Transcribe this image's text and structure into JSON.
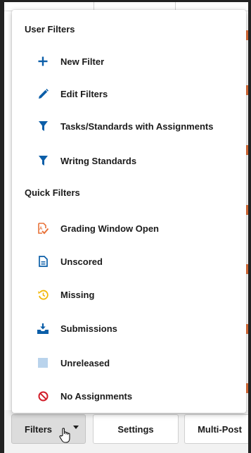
{
  "menu": {
    "user_filters_title": "User Filters",
    "quick_filters_title": "Quick Filters",
    "user_filters": [
      {
        "label": "New Filter",
        "icon": "plus-icon"
      },
      {
        "label": "Edit Filters",
        "icon": "pencil-icon"
      },
      {
        "label": "Tasks/Standards with Assignments",
        "icon": "funnel-icon"
      },
      {
        "label": "Writng Standards",
        "icon": "funnel-icon"
      }
    ],
    "quick_filters": [
      {
        "label": "Grading Window Open",
        "icon": "grading-window-icon"
      },
      {
        "label": "Unscored",
        "icon": "document-icon"
      },
      {
        "label": "Missing",
        "icon": "history-icon"
      },
      {
        "label": "Submissions",
        "icon": "inbox-download-icon"
      },
      {
        "label": "Unreleased",
        "icon": "square-icon"
      },
      {
        "label": "No Assignments",
        "icon": "prohibited-icon"
      }
    ]
  },
  "toolbar": {
    "filters_label": "Filters",
    "settings_label": "Settings",
    "multipost_label": "Multi-Post"
  },
  "colors": {
    "blue": "#0b5ea8",
    "orange": "#e8733a",
    "yellow": "#f2b705",
    "light_blue": "#b9d3ec",
    "red": "#d21f2b"
  }
}
